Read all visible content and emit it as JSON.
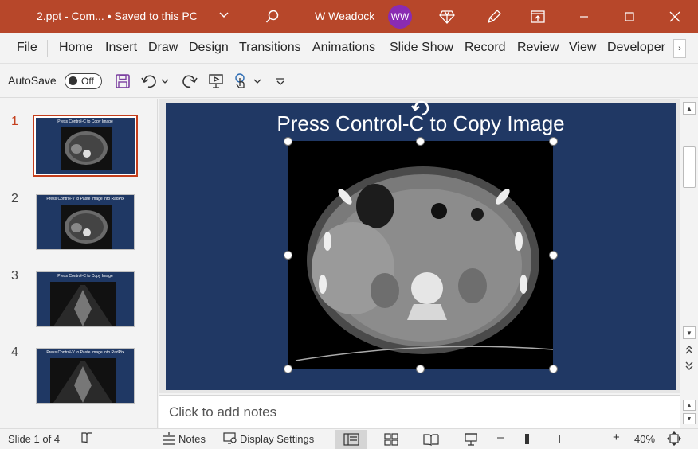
{
  "titlebar": {
    "doc_title": "2.ppt  -  Com...  •  Saved to this PC",
    "user_name": "W Weadock",
    "user_initials": "WW"
  },
  "menu": {
    "tabs": [
      "File",
      "Home",
      "Insert",
      "Draw",
      "Design",
      "Transitions",
      "Animations",
      "Slide Show",
      "Record",
      "Review",
      "View",
      "Developer"
    ],
    "more": "›"
  },
  "qat": {
    "autosave_label": "AutoSave",
    "autosave_state": "Off"
  },
  "thumbnails": [
    {
      "number": "1",
      "title": "Press Control-C to Copy Image",
      "selected": true
    },
    {
      "number": "2",
      "title": "Press Control-V to Paste Image into RadPix",
      "selected": false
    },
    {
      "number": "3",
      "title": "Press Control-C to Copy Image",
      "selected": false
    },
    {
      "number": "4",
      "title": "Press Control-V to Paste Image into RadPix",
      "selected": false
    }
  ],
  "slide": {
    "title": "Press Control-C to Copy Image"
  },
  "notes": {
    "placeholder": "Click to add notes"
  },
  "status": {
    "slide_info": "Slide 1 of 4",
    "notes_label": "Notes",
    "display_settings_label": "Display Settings",
    "zoom_minus": "–",
    "zoom_plus": "+",
    "zoom_level": "40%",
    "zoom_fraction": 0.4
  },
  "colors": {
    "titlebar": "#b7472a",
    "slide_bg": "#203864",
    "accent": "#c43e1c",
    "avatar": "#8a2bb3"
  }
}
